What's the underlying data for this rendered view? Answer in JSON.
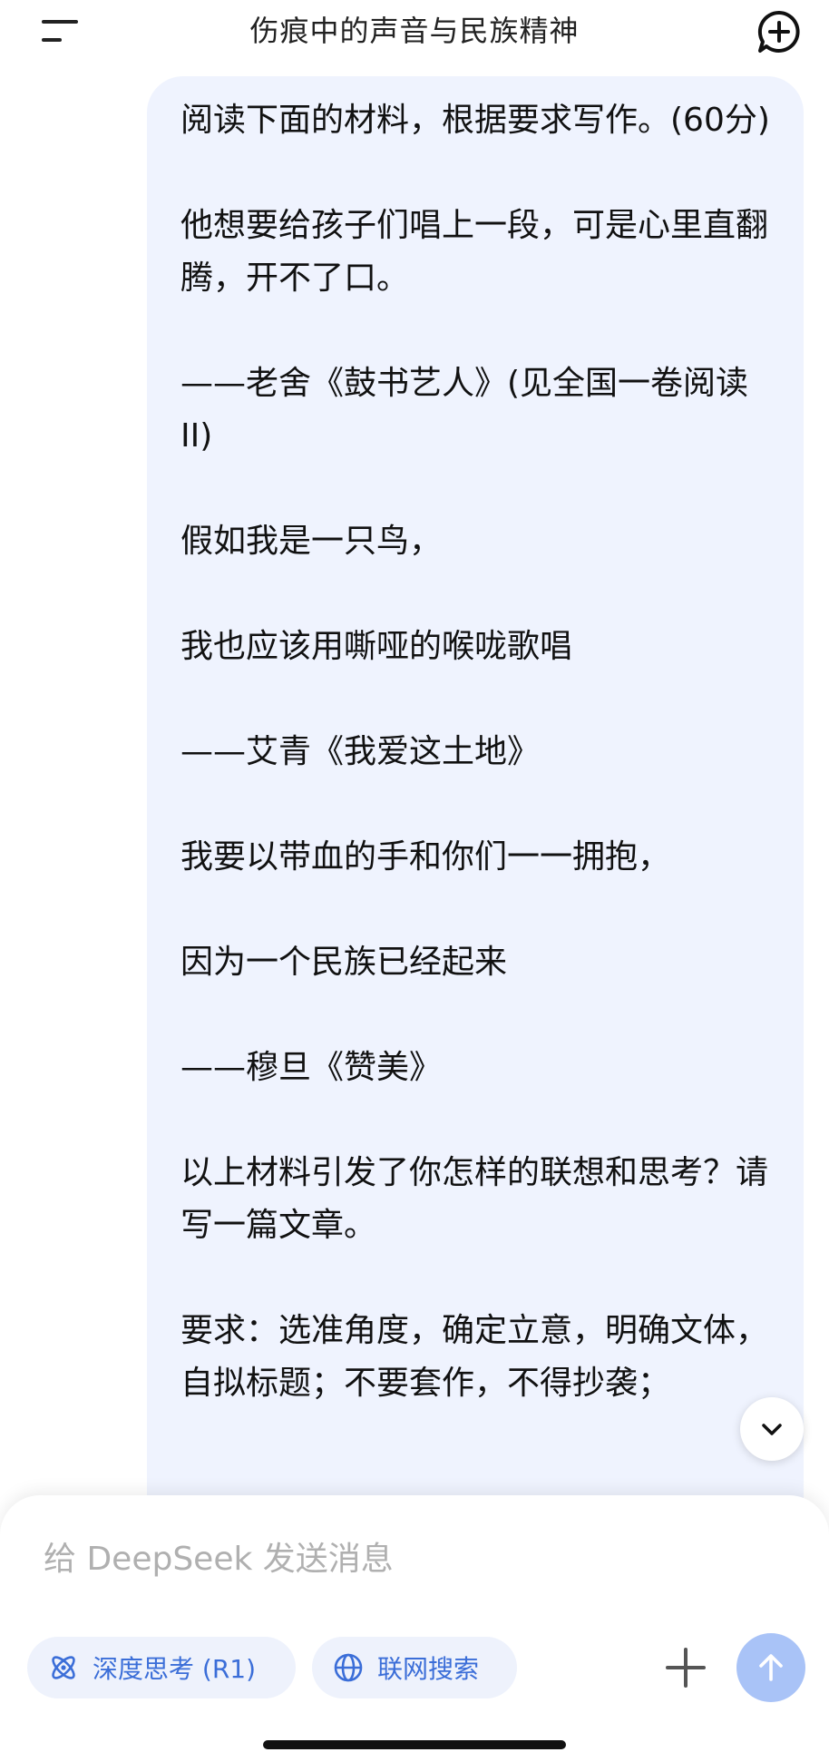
{
  "header": {
    "title": "伤痕中的声音与民族精神"
  },
  "message": {
    "paragraphs": [
      "阅读下面的材料，根据要求写作。(60分)",
      "他想要给孩子们唱上一段，可是心里直翻腾，开不了口。",
      "——老舍《鼓书艺人》(见全国一卷阅读II)",
      "假如我是一只鸟，",
      "我也应该用嘶哑的喉咙歌唱",
      "——艾青《我爱这土地》",
      "我要以带血的手和你们一一拥抱，",
      "因为一个民族已经起来",
      "——穆旦《赞美》",
      "以上材料引发了你怎样的联想和思考？请写一篇文章。",
      "要求：选准角度，确定立意，明确文体，自拟标题；不要套作，不得抄袭；"
    ]
  },
  "composer": {
    "placeholder": "给 DeepSeek 发送消息",
    "value": "",
    "deep_think_label": "深度思考 (R1)",
    "web_search_label": "联网搜索"
  },
  "icons": {
    "menu": "menu-icon",
    "new_chat": "new-chat-icon",
    "scroll_down": "chevron-down-icon",
    "deep_think": "atom-icon",
    "web_search": "globe-icon",
    "attach": "plus-icon",
    "send": "arrow-up-icon"
  },
  "colors": {
    "bubble_bg": "#eff3fe",
    "accent": "#3b6ed8",
    "chip_bg": "#eef2fc",
    "send_button": "#a9c3f7",
    "placeholder": "#b0b0b0"
  }
}
